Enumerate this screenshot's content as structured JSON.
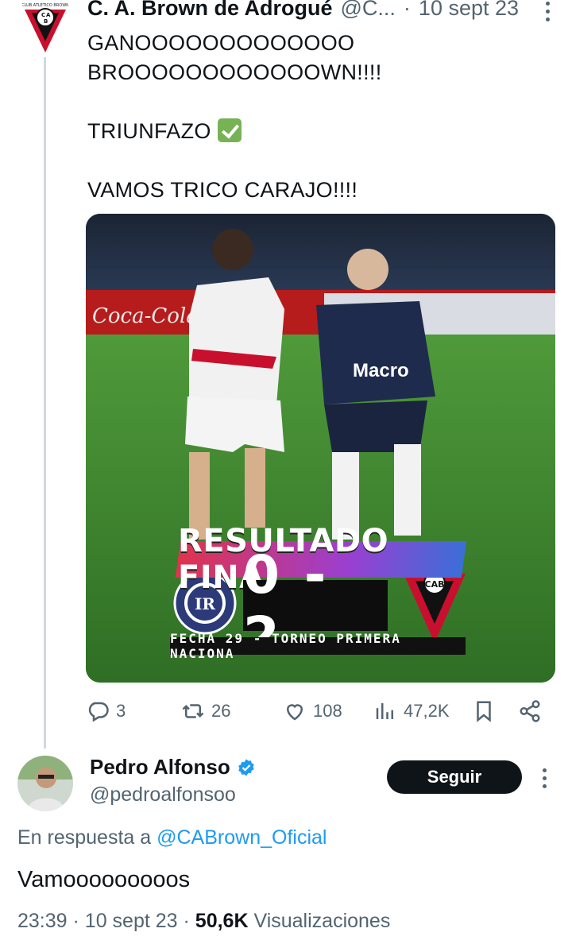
{
  "parent_tweet": {
    "author_name": "C. A. Brown de Adrogué",
    "author_handle": "@C...",
    "date": "10 sept 23",
    "lines": [
      "GANOOOOOOOOOOOOO",
      "BROOOOOOOOOOOOWN!!!!",
      "",
      "TRIUNFAZO",
      "",
      "VAMOS TRICO CARAJO!!!!"
    ],
    "check_emoji": "white-heavy-check-mark",
    "media": {
      "title": "RESULTADO FINAL",
      "score": "0 - 2",
      "subtitle": "FECHA 29 - TORNEO PRIMERA NACIONA",
      "sponsor": "Macro",
      "home_badge_text": "INDEPENDIENTE RIVADAVIA",
      "home_badge_city": "MENDOZA",
      "away_badge_text": "C A B",
      "accent_red": "#c8102e",
      "pitch_green": "#3f8a33"
    },
    "actions": {
      "replies": "3",
      "retweets": "26",
      "likes": "108",
      "views": "47,2K"
    }
  },
  "reply": {
    "author_name": "Pedro Alfonso",
    "author_handle": "@pedroalfonsoo",
    "follow_label": "Seguir",
    "in_reply_prefix": "En respuesta a ",
    "in_reply_mention": "@CABrown_Oficial",
    "text": "Vamooooooooos",
    "time": "23:39",
    "date": "10 sept 23",
    "views_count": "50,6K",
    "views_label": "Visualizaciones",
    "verified_color": "#1d9bf0"
  }
}
